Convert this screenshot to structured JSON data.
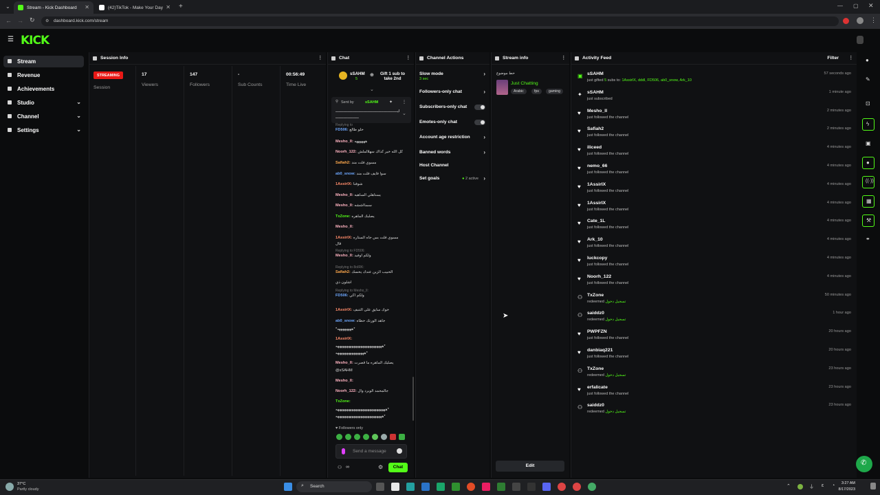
{
  "browser": {
    "tabs": [
      {
        "label": "Stream - Kick Dashboard",
        "active": true
      },
      {
        "label": "(42)TikTok - Make Your Day",
        "active": false
      }
    ],
    "url": "dashboard.kick.com/stream"
  },
  "brand": {
    "logo": "KICK",
    "accent": "#53fc18"
  },
  "sidebar": {
    "items": [
      {
        "label": "Stream",
        "icon": "stream-icon",
        "active": true
      },
      {
        "label": "Revenue",
        "icon": "revenue-icon"
      },
      {
        "label": "Achievements",
        "icon": "trophy-icon"
      },
      {
        "label": "Studio",
        "icon": "studio-icon",
        "expandable": true
      },
      {
        "label": "Channel",
        "icon": "channel-icon",
        "expandable": true
      },
      {
        "label": "Settings",
        "icon": "gear-icon",
        "expandable": true
      }
    ]
  },
  "session": {
    "title": "Session Info",
    "status": "STREAMING",
    "status_label": "Session",
    "stats": [
      {
        "value": "17",
        "label": "Viewers"
      },
      {
        "value": "147",
        "label": "Followers"
      },
      {
        "value": "-",
        "label": "Sub Counts"
      },
      {
        "value": "00:56:49",
        "label": "Time Live"
      }
    ]
  },
  "chat": {
    "title": "Chat",
    "pinned": {
      "user": "sSAHM",
      "count": "5",
      "gift": "Gift 1 sub to take 2nd"
    },
    "sent_by": "Sent by",
    "sent_by_user": "sSAHM",
    "pinned_text": "ايــــــــــــــــــــــــــــــــــــــــــــــــــــــــ",
    "pinned_text2": "ـــــــــــــــــــــ",
    "messages": [
      {
        "reply": "Replying to",
        "user": "FD506",
        "text": "حلو طالع",
        "color": "b"
      },
      {
        "user": "Mesho_lI",
        "text": "ههههههه",
        "color": "p"
      },
      {
        "user": "Noorh_122",
        "text": "كل الله خير كذاك سهلالملش",
        "color": "p"
      },
      {
        "user": "Safiah2",
        "text": "مسوي فلت مند",
        "color": "o"
      },
      {
        "user": "ab0_snow",
        "text": "سوا فايف فلت مند",
        "color": "b"
      },
      {
        "user": "1AssirIX",
        "text": "شوفنا",
        "color": "g"
      },
      {
        "user": "Mesho_lI",
        "text": "يستاهلي الساهيه",
        "color": "p"
      },
      {
        "user": "Mesho_lI",
        "text": "سسااششه",
        "color": "p"
      },
      {
        "user": "TxZone",
        "text": "يصلبك الماهره",
        "color": "gr"
      },
      {
        "user": "Mesho_lI",
        "text": "",
        "color": "p"
      },
      {
        "user": "1AssirIX",
        "text": "مسوي فلت بس جاه الستاره",
        "color": "g"
      },
      {
        "user": "",
        "text": "قال",
        "color": "g"
      },
      {
        "reply": "Replying to FD506:",
        "user": "Mesho_lI",
        "text": "ولكم اوفيد",
        "color": "p"
      },
      {
        "reply": "Replying to 8oIRK:",
        "user": "Safiah2",
        "text": "الحبيب الزين عندك يحسك",
        "color": "o"
      },
      {
        "user": "",
        "text": "اشلون ذي",
        "color": "o"
      },
      {
        "reply": "Replying to Mesho_lI:",
        "user": "FD506",
        "text": "ولكم اكي",
        "color": "b"
      },
      {
        "user": "1AssirIX",
        "text": "خوك سايق على التنبف",
        "color": "g"
      },
      {
        "user": "ab0_snow",
        "text": "جاهد الورنك حطاه",
        "color": "b"
      },
      {
        "user": "",
        "text": "*ههههههههه*",
        "color": "b"
      },
      {
        "user": "1AssirIX",
        "text": "",
        "color": "g"
      },
      {
        "user": "",
        "text": "ههههههههههههههههههههههههههه*",
        "color": "g"
      },
      {
        "user": "",
        "text": "ههههههههههههههههه*",
        "color": "g"
      },
      {
        "user": "Mesho_lI",
        "text": "يصليك الماهره ما قصرت",
        "color": "p"
      },
      {
        "user": "",
        "text": "@sSAHM",
        "color": "p"
      },
      {
        "user": "Mesho_lI",
        "text": "",
        "color": "p"
      },
      {
        "user": "Noorh_122",
        "text": "جالمحمد الويرد وال",
        "color": "p"
      },
      {
        "user": "TxZone",
        "text": "",
        "color": "gr"
      },
      {
        "user": "",
        "text": "ههههههههههههههههههههههههههههه*",
        "color": "gr"
      },
      {
        "user": "",
        "text": "ههههههههههههههههههههههههههه*",
        "color": "gr"
      }
    ],
    "followers_only": "Followers only",
    "placeholder": "Send a message",
    "send_label": "Chat",
    "count_label": "∞"
  },
  "actions": {
    "title": "Channel Actions",
    "slow_mode": "Slow mode",
    "slow_mode_value": "3 sec",
    "followers_only": "Followers-only chat",
    "subscribers_only": "Subscribers-only chat",
    "emotes_only": "Emotes-only chat",
    "age_restriction": "Account age restriction",
    "banned_words": "Banned words",
    "host_channel": "Host Channel",
    "set_goals": "Set goals",
    "goals_active": "2 active"
  },
  "stream_info": {
    "title": "Stream info",
    "stream_title": "حط موضوع",
    "category": "Just Chatting",
    "tags": [
      "Arabic",
      "fps",
      "gaming"
    ],
    "edit": "Edit"
  },
  "feed": {
    "title": "Activity Feed",
    "filter": "Filter",
    "items": [
      {
        "name": "sSAHM",
        "desc_pre": "just gifted",
        "desc_num": "5",
        "desc_mid": "subs to:",
        "desc_users": "1AssirIX, dddl, FD506, ab0_snow, Ark_10",
        "time": "57 seconds ago",
        "icon": "gift-icon"
      },
      {
        "name": "sSAHM",
        "desc": "just subscribed",
        "time": "1 minute ago",
        "icon": "star-icon"
      },
      {
        "name": "Mesho_lI",
        "desc": "just followed the channel",
        "time": "2 minutes ago",
        "icon": "heart-icon"
      },
      {
        "name": "Safiah2",
        "desc": "just followed the channel",
        "time": "2 minutes ago",
        "icon": "heart-icon"
      },
      {
        "name": "iliceed",
        "desc": "just followed the channel",
        "time": "4 minutes ago",
        "icon": "heart-icon"
      },
      {
        "name": "nemo_66",
        "desc": "just followed the channel",
        "time": "4 minutes ago",
        "icon": "heart-icon"
      },
      {
        "name": "1AssirIX",
        "desc": "just followed the channel",
        "time": "4 minutes ago",
        "icon": "heart-icon"
      },
      {
        "name": "1AssirIX",
        "desc": "just followed the channel",
        "time": "4 minutes ago",
        "icon": "heart-icon"
      },
      {
        "name": "Cate_1L",
        "desc": "just followed the channel",
        "time": "4 minutes ago",
        "icon": "heart-icon"
      },
      {
        "name": "Ark_10",
        "desc": "just followed the channel",
        "time": "4 minutes ago",
        "icon": "heart-icon"
      },
      {
        "name": "luckcopy",
        "desc": "just followed the channel",
        "time": "4 minutes ago",
        "icon": "heart-icon"
      },
      {
        "name": "Noorh_122",
        "desc": "just followed the channel",
        "time": "4 minutes ago",
        "icon": "heart-icon"
      },
      {
        "name": "TxZone",
        "desc_pre": "redeemed",
        "desc_green": "تسجيل دخول",
        "time": "50 minutes ago",
        "icon": "redeem-icon"
      },
      {
        "name": "saiddz0",
        "desc_pre": "redeemed",
        "desc_green": "تسجيل دخول",
        "time": "1 hour ago",
        "icon": "redeem-icon"
      },
      {
        "name": "PWPFZN",
        "desc": "just followed the channel",
        "time": "20 hours ago",
        "icon": "heart-icon"
      },
      {
        "name": "danbiaq221",
        "desc": "just followed the channel",
        "time": "20 hours ago",
        "icon": "heart-icon"
      },
      {
        "name": "TxZone",
        "desc_pre": "redeemed",
        "desc_green": "تسجيل دخول",
        "time": "23 hours ago",
        "icon": "redeem-icon"
      },
      {
        "name": "erfalicate",
        "desc": "just followed the channel",
        "time": "23 hours ago",
        "icon": "heart-icon"
      },
      {
        "name": "saiddz0",
        "desc_pre": "redeemed",
        "desc_green": "تسجيل دخول",
        "time": "23 hours ago",
        "icon": "redeem-icon"
      }
    ]
  },
  "taskbar": {
    "weather_temp": "37°C",
    "weather_desc": "Partly cloudy",
    "search": "Search",
    "time": "3:27 AM",
    "date": "8/17/2023"
  }
}
